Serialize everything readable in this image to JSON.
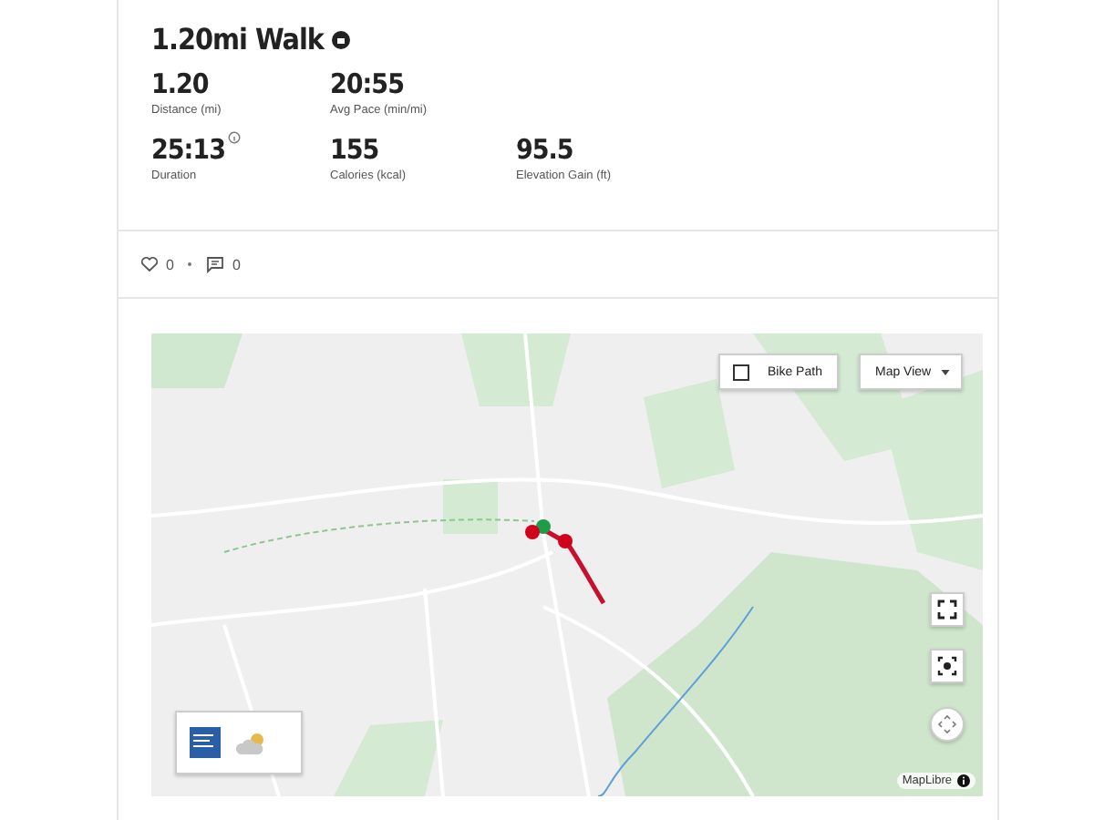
{
  "activity": {
    "title": "1.20mi Walk",
    "stat_rows": [
      [
        {
          "value": "1.20",
          "label": "Distance (mi)",
          "info": false
        },
        {
          "value": "20:55",
          "label": "Avg Pace (min/mi)",
          "info": false
        }
      ],
      [
        {
          "value": "25:13",
          "label": "Duration",
          "info": true
        },
        {
          "value": "155",
          "label": "Calories (kcal)",
          "info": false
        },
        {
          "value": "95.5",
          "label": "Elevation Gain (ft)",
          "info": false
        }
      ]
    ],
    "likes": "0",
    "comments": "0"
  },
  "map": {
    "kind": "picture",
    "bike_path": {
      "label": "Bike Path",
      "checked": false
    },
    "view_select": {
      "value": "Map View"
    },
    "attribution": "MapLibre"
  }
}
